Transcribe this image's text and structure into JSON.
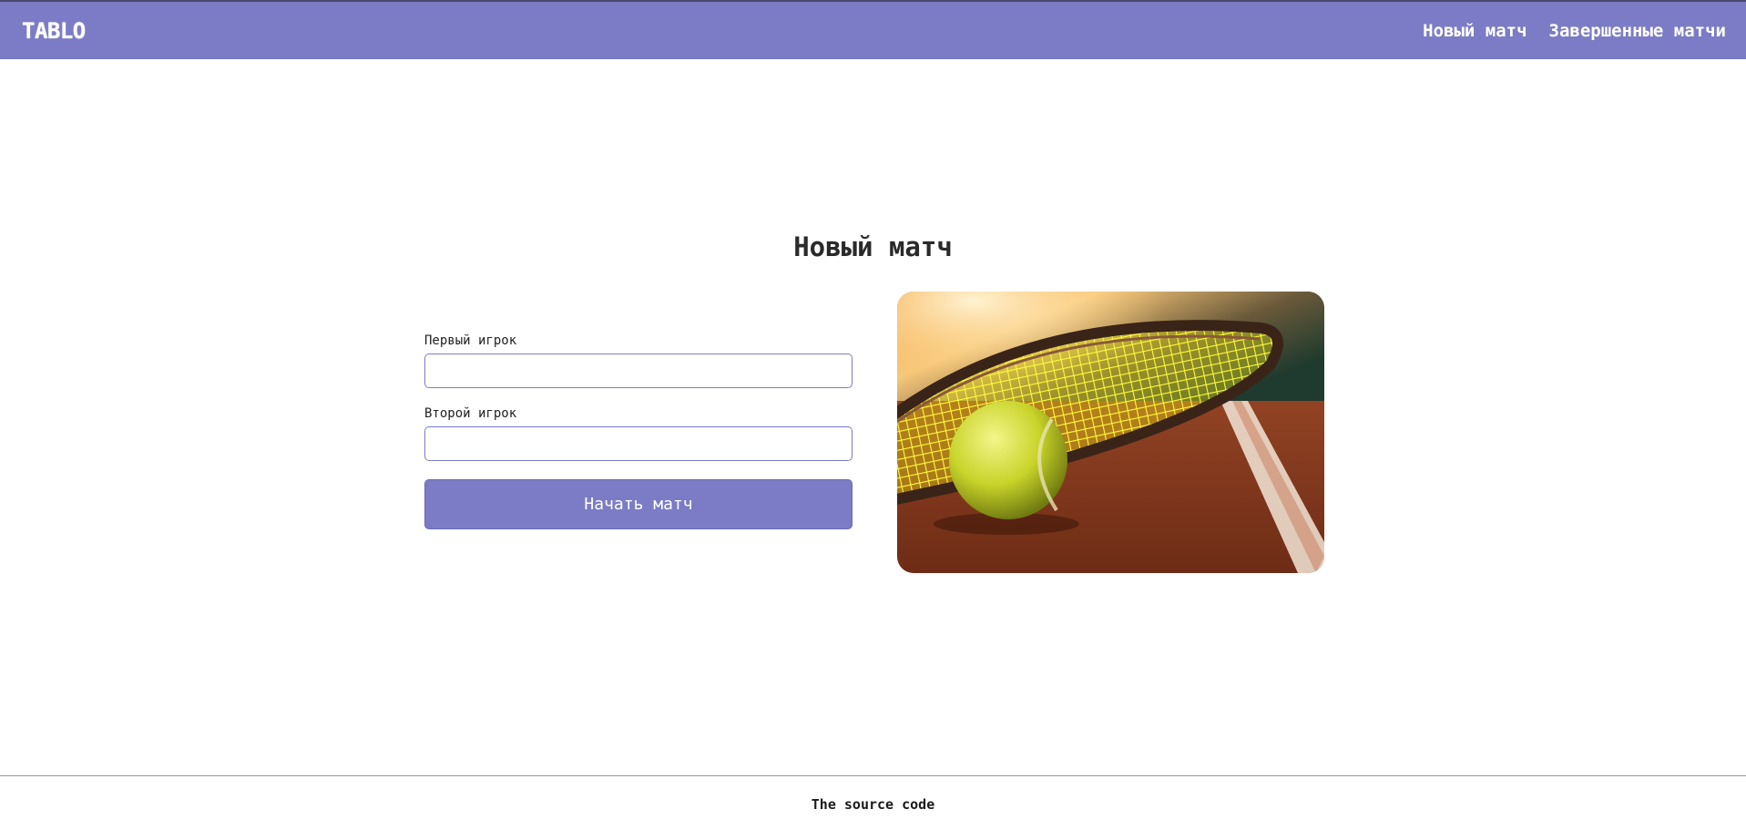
{
  "header": {
    "logo": "TABLO",
    "nav": [
      {
        "label": "Новый матч"
      },
      {
        "label": "Завершенные матчи"
      }
    ],
    "background_color": "#7b7cc5"
  },
  "main": {
    "title": "Новый матч",
    "form": {
      "player1_label": "Первый игрок",
      "player1_value": "",
      "player2_label": "Второй игрок",
      "player2_value": "",
      "submit_label": "Начать матч"
    },
    "image": "tennis-ball-and-racket-photo"
  },
  "footer": {
    "link_label": "The source code"
  }
}
